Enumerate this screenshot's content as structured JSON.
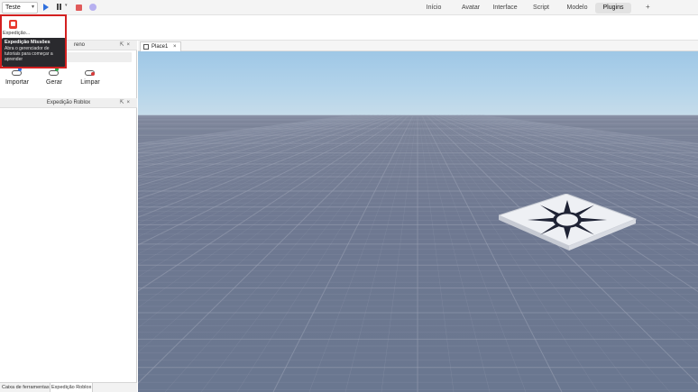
{
  "menubar": {
    "mode": "Teste",
    "tabs": [
      {
        "label": "Início",
        "active": false
      },
      {
        "label": "Avatar",
        "active": false
      },
      {
        "label": "Interface",
        "active": false
      },
      {
        "label": "Script",
        "active": false
      },
      {
        "label": "Modelo",
        "active": false
      },
      {
        "label": "Plugins",
        "active": true
      }
    ],
    "add_tab": "+"
  },
  "ribbon": {
    "expedition_label": "Expedição...",
    "tooltip_title": "Expedição Missões",
    "tooltip_body": "Abra o gerenciador de tutoriais para começar a aprender"
  },
  "terrain_panel": {
    "title_partial": "reno",
    "buttons": [
      {
        "label": "Importar"
      },
      {
        "label": "Gerar"
      },
      {
        "label": "Limpar"
      }
    ]
  },
  "roblox_panel": {
    "title": "Expedição Roblox"
  },
  "bottom_tabs": [
    {
      "label": "Caixa de ferramentas",
      "active": false
    },
    {
      "label": "Expedição Roblox",
      "active": true
    }
  ],
  "document": {
    "tab_label": "Place1",
    "close": "×"
  },
  "colors": {
    "highlight": "#d32020",
    "accent_blue": "#2f6fdd",
    "stop_red": "#e05a5a"
  }
}
